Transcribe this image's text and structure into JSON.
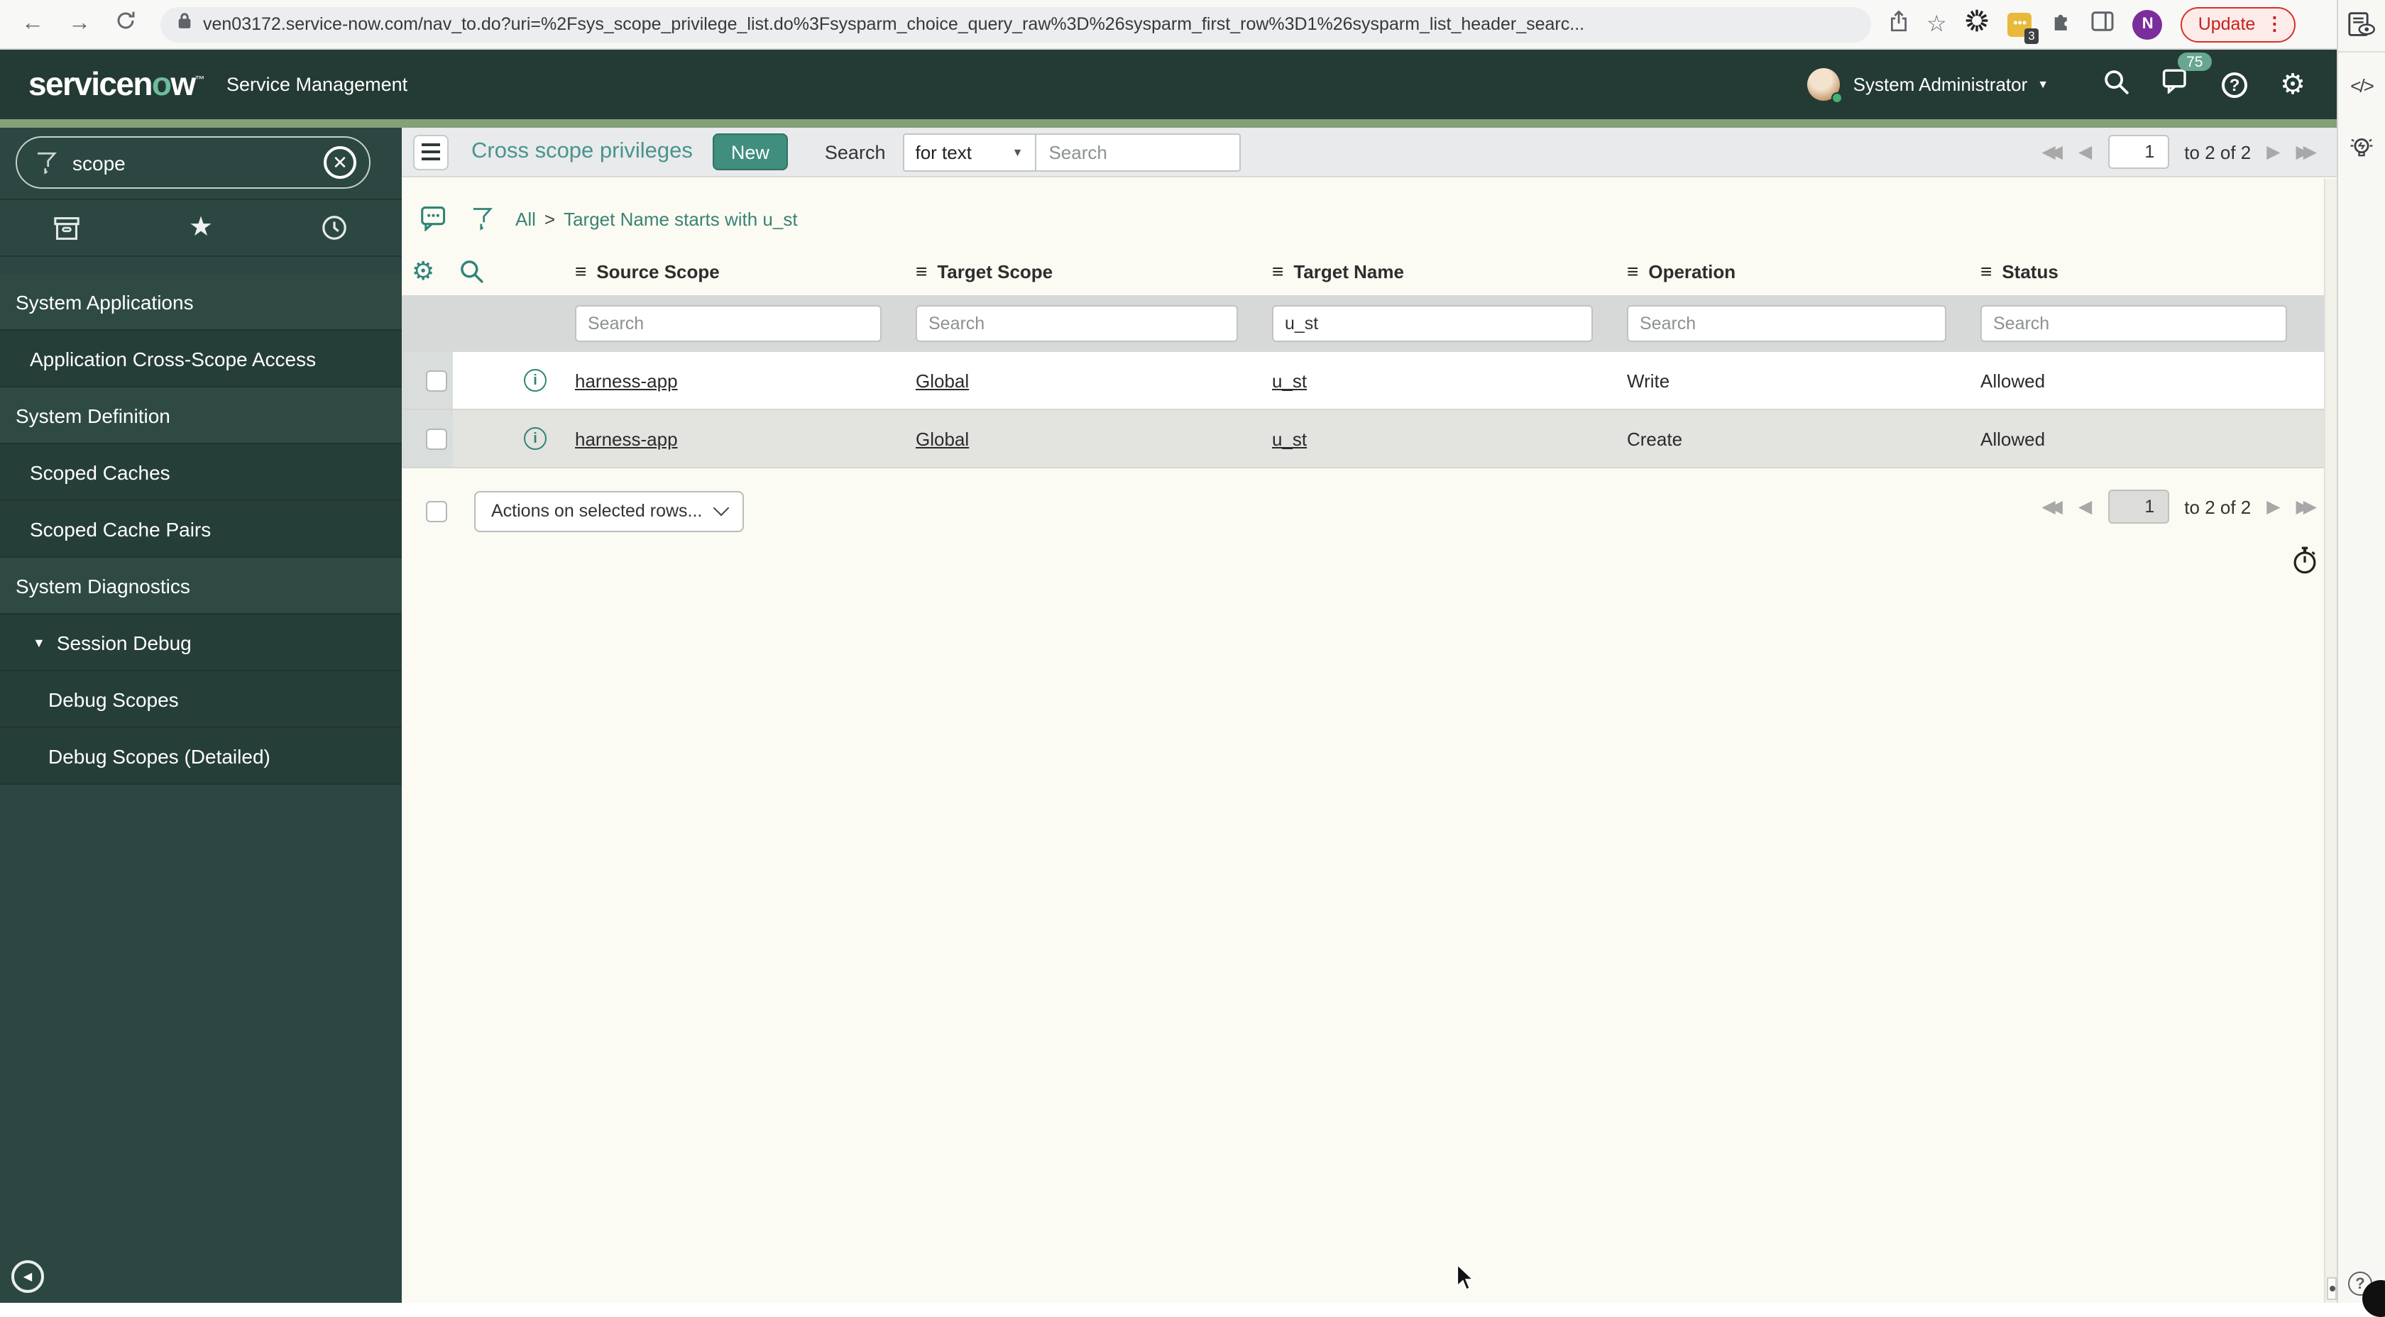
{
  "colors": {
    "brand_header": "#243a34",
    "brand_strip": "#83a077",
    "accent_teal": "#3f8e7e",
    "update_red": "#c5221f",
    "badge_green": "#68a691"
  },
  "browser": {
    "url": "ven03172.service-now.com/nav_to.do?uri=%2Fsys_scope_privilege_list.do%3Fsysparm_choice_query_raw%3D%26sysparm_first_row%3D1%26sysparm_list_header_searc...",
    "update_label": "Update",
    "kebab": "⋮",
    "profile_initial": "N",
    "extension_badge": "3"
  },
  "header": {
    "logo_prefix": "servicen",
    "logo_o": "o",
    "logo_suffix": "w",
    "trademark": "™",
    "product": "Service Management",
    "user_name": "System Administrator",
    "notification_count": "75",
    "help_glyph": "?"
  },
  "sidebar": {
    "filter_value": "scope",
    "clear_glyph": "✕",
    "items": [
      {
        "label": "System Applications",
        "type": "section"
      },
      {
        "label": "Application Cross-Scope Access",
        "type": "module"
      },
      {
        "label": "System Definition",
        "type": "section"
      },
      {
        "label": "Scoped Caches",
        "type": "module"
      },
      {
        "label": "Scoped Cache Pairs",
        "type": "module"
      },
      {
        "label": "System Diagnostics",
        "type": "section"
      },
      {
        "label": "Session Debug",
        "type": "expander",
        "expanded_glyph": "▼"
      },
      {
        "label": "Debug Scopes",
        "type": "submodule"
      },
      {
        "label": "Debug Scopes (Detailed)",
        "type": "submodule"
      }
    ]
  },
  "toolbar": {
    "title": "Cross scope privileges",
    "new_button": "New",
    "search_label": "Search",
    "search_type": "for text",
    "search_placeholder": "Search"
  },
  "breadcrumb": {
    "root": "All",
    "separator": ">",
    "filter": "Target Name starts with u_st"
  },
  "pagination": {
    "page": "1",
    "range_text": "to 2 of 2"
  },
  "list": {
    "columns": [
      "Source Scope",
      "Target Scope",
      "Target Name",
      "Operation",
      "Status"
    ],
    "column_search_placeholder": "Search",
    "column_search_values": [
      "",
      "",
      "u_st",
      "",
      ""
    ],
    "link_column_count": 3,
    "rows": [
      {
        "cells": [
          "harness-app",
          "Global",
          "u_st",
          "Write",
          "Allowed"
        ]
      },
      {
        "cells": [
          "harness-app",
          "Global",
          "u_st",
          "Create",
          "Allowed"
        ]
      }
    ],
    "actions_label": "Actions on selected rows..."
  }
}
